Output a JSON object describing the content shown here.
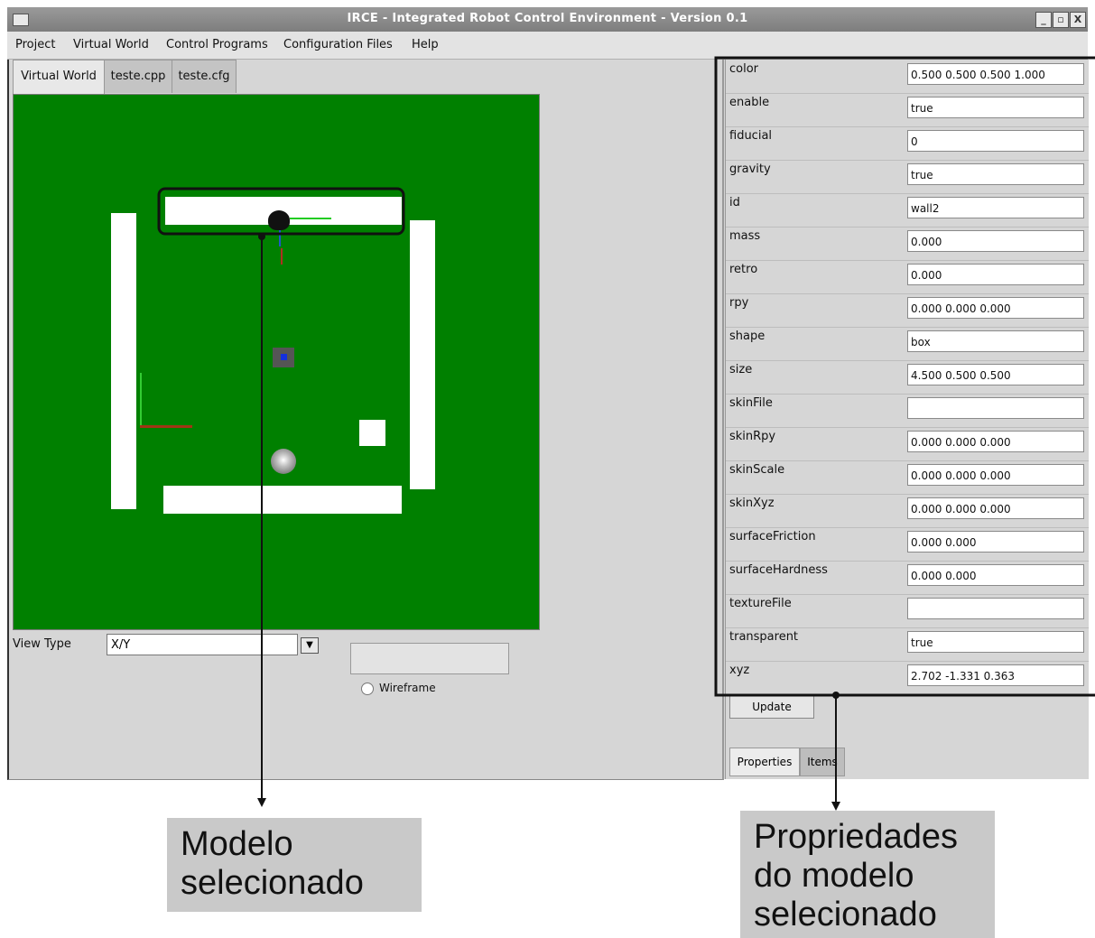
{
  "window": {
    "title": "IRCE - Integrated Robot Control Environment - Version 0.1",
    "controls": [
      "_",
      "▫",
      "X"
    ]
  },
  "menu": [
    "Project",
    "Virtual World",
    "Control Programs",
    "Configuration Files",
    "Help"
  ],
  "tabs": [
    "Virtual World",
    "teste.cpp",
    "teste.cfg"
  ],
  "view": {
    "type_label": "View Type",
    "type_value": "X/Y",
    "dropdown_arrow": "▼",
    "wireframe_label": "Wireframe"
  },
  "properties": [
    {
      "name": "color",
      "value": "0.500 0.500 0.500 1.000"
    },
    {
      "name": "enable",
      "value": "true"
    },
    {
      "name": "fiducial",
      "value": "0"
    },
    {
      "name": "gravity",
      "value": "true"
    },
    {
      "name": "id",
      "value": "wall2"
    },
    {
      "name": "mass",
      "value": "0.000"
    },
    {
      "name": "retro",
      "value": "0.000"
    },
    {
      "name": "rpy",
      "value": "0.000 0.000 0.000"
    },
    {
      "name": "shape",
      "value": "box"
    },
    {
      "name": "size",
      "value": "4.500 0.500 0.500"
    },
    {
      "name": "skinFile",
      "value": ""
    },
    {
      "name": "skinRpy",
      "value": "0.000 0.000 0.000"
    },
    {
      "name": "skinScale",
      "value": "0.000 0.000 0.000"
    },
    {
      "name": "skinXyz",
      "value": "0.000 0.000 0.000"
    },
    {
      "name": "surfaceFriction",
      "value": "0.000 0.000"
    },
    {
      "name": "surfaceHardness",
      "value": "0.000 0.000"
    },
    {
      "name": "textureFile",
      "value": ""
    },
    {
      "name": "transparent",
      "value": "true"
    },
    {
      "name": "xyz",
      "value": "2.702 -1.331 0.363"
    }
  ],
  "update_label": "Update",
  "bottom_tabs": [
    "Properties",
    "Items"
  ],
  "annotations": {
    "left_line1": "Modelo",
    "left_line2": "selecionado",
    "right_line1": "Propriedades",
    "right_line2": "do modelo",
    "right_line3": "selecionado"
  },
  "colors": {
    "floor": "#008000",
    "wall": "#ffffff",
    "callout_bg": "#c9c9c9"
  }
}
